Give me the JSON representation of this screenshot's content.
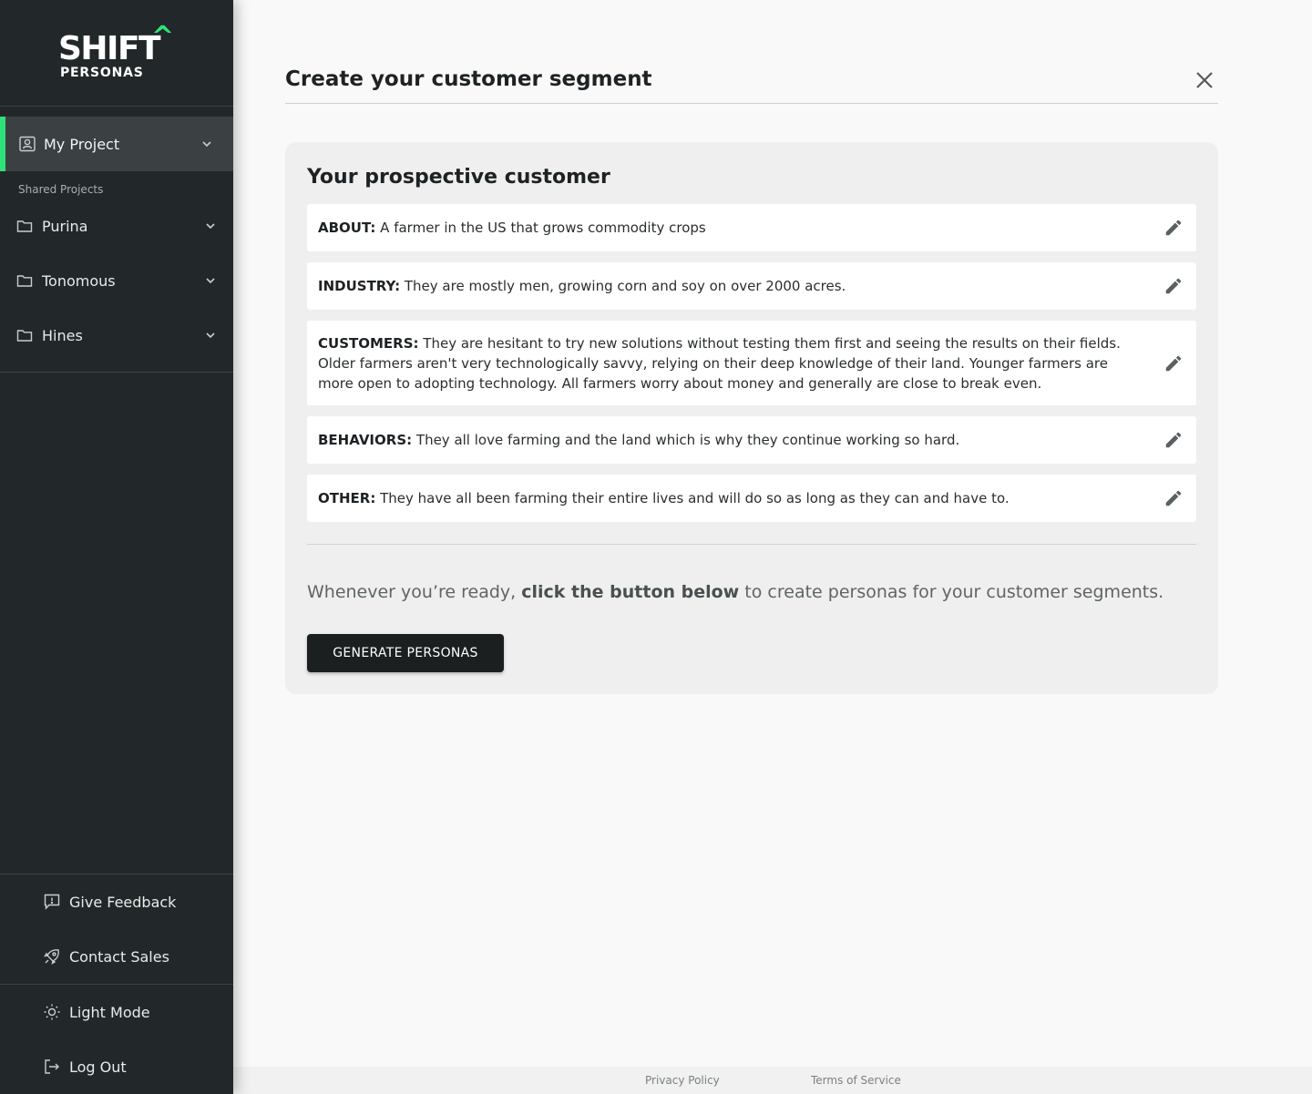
{
  "brand": {
    "name": "SHIFT",
    "caret": "^",
    "subtitle": "PERSONAS",
    "accent": "#2ee27a"
  },
  "sidebar": {
    "current_project": "My Project",
    "shared_label": "Shared Projects",
    "shared_projects": [
      {
        "label": "Purina"
      },
      {
        "label": "Tonomous"
      },
      {
        "label": "Hines"
      }
    ],
    "bottom": {
      "feedback": "Give Feedback",
      "contact": "Contact Sales",
      "light_mode": "Light Mode",
      "logout": "Log Out"
    }
  },
  "main": {
    "title": "Create your customer segment",
    "card_title": "Your prospective customer",
    "fields": [
      {
        "key": "ABOUT:",
        "value": "A farmer in the US that grows commodity crops"
      },
      {
        "key": "INDUSTRY:",
        "value": "They are mostly men, growing corn and soy on over 2000 acres."
      },
      {
        "key": "CUSTOMERS:",
        "value": "They are hesitant to try new solutions without testing them first and seeing the results on their fields. Older farmers aren't very technologically savvy, relying on their deep knowledge of their land. Younger farmers are more open to adopting technology. All farmers worry about money and generally are close to break even."
      },
      {
        "key": "BEHAVIORS:",
        "value": "They all love farming and the land which is why they continue working so hard."
      },
      {
        "key": "OTHER:",
        "value": "They have all been farming their entire lives and will do so as long as they can and have to."
      }
    ],
    "ready_pre": "Whenever you’re ready,",
    "ready_bold": "click the button below",
    "ready_post": "to create personas for your customer segments.",
    "generate_button": "GENERATE PERSONAS"
  },
  "footer": {
    "privacy": "Privacy Policy",
    "terms": "Terms of Service"
  }
}
